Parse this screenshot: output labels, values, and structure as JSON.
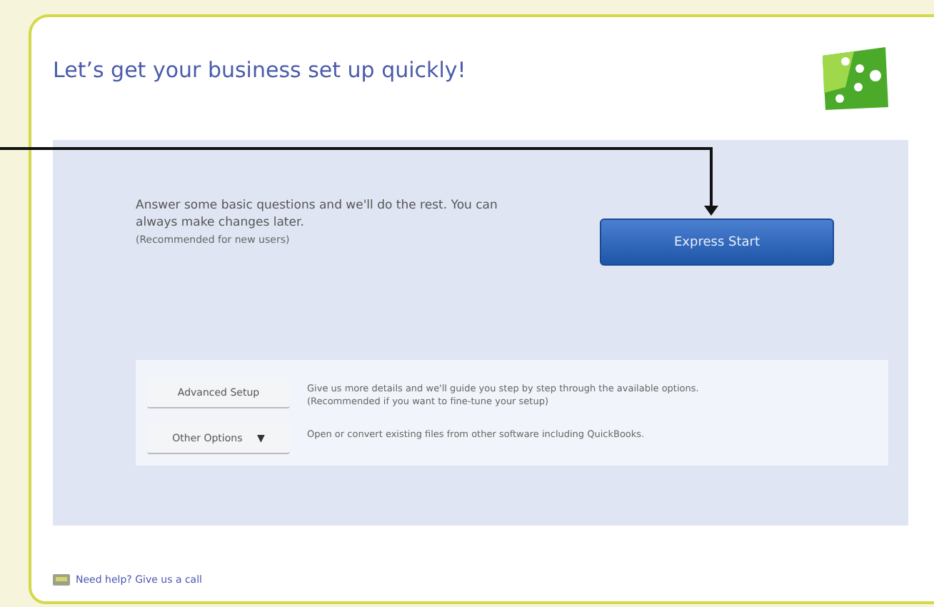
{
  "title": "Let’s get your business set up quickly!",
  "express": {
    "description": "Answer some basic questions and we'll do the rest. You can always make changes later.",
    "note": "(Recommended for new users)",
    "button": "Express Start"
  },
  "options": [
    {
      "kind": "button",
      "button": "Advanced Setup",
      "description": "Give us more details and we'll guide you step by step through the available options.",
      "note": "(Recommended if you want to fine-tune your setup)"
    },
    {
      "kind": "dropdown",
      "button": "Other Options",
      "caret": "▼",
      "description": "Open or convert existing files from other software including QuickBooks."
    }
  ],
  "help_link": "Need help? Give us a call"
}
